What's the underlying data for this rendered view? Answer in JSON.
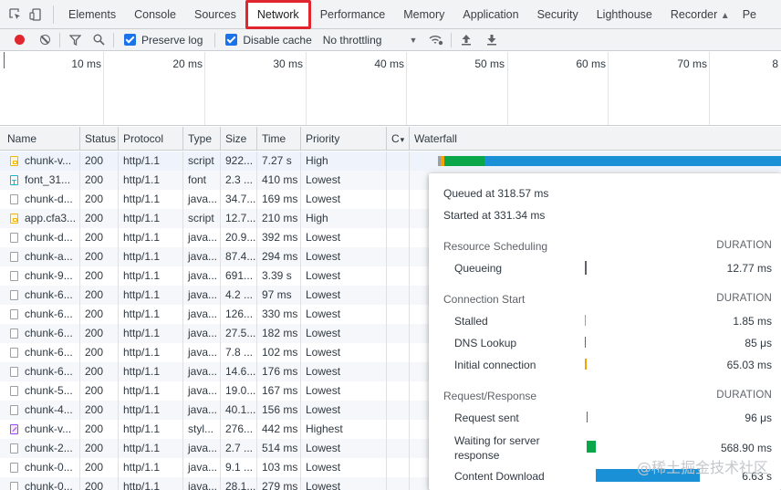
{
  "tabbar": {
    "icons": [
      "inspect-element-icon",
      "device-toolbar-icon"
    ],
    "tabs": [
      "Elements",
      "Console",
      "Sources",
      "Network",
      "Performance",
      "Memory",
      "Application",
      "Security",
      "Lighthouse",
      "Recorder",
      "Pe"
    ],
    "selected_tab": "Network",
    "recorder_icon": "flask-icon"
  },
  "toolbar": {
    "preserve_log": "Preserve log",
    "preserve_log_checked": true,
    "disable_cache": "Disable cache",
    "disable_cache_checked": true,
    "throttling": "No throttling"
  },
  "overview": {
    "ticks": [
      "10 ms",
      "20 ms",
      "30 ms",
      "40 ms",
      "50 ms",
      "60 ms",
      "70 ms",
      "8"
    ]
  },
  "table": {
    "columns": [
      "Name",
      "Status",
      "Protocol",
      "Type",
      "Size",
      "Time",
      "Priority",
      "C",
      "Waterfall"
    ],
    "rows": [
      {
        "icon": "js",
        "name": "chunk-v...",
        "status": "200",
        "protocol": "http/1.1",
        "type": "script",
        "size": "922...",
        "time": "7.27 s",
        "priority": "High"
      },
      {
        "icon": "font",
        "name": "font_31...",
        "status": "200",
        "protocol": "http/1.1",
        "type": "font",
        "size": "2.3 ...",
        "time": "410 ms",
        "priority": "Lowest"
      },
      {
        "icon": "doc",
        "name": "chunk-d...",
        "status": "200",
        "protocol": "http/1.1",
        "type": "java...",
        "size": "34.7...",
        "time": "169 ms",
        "priority": "Lowest"
      },
      {
        "icon": "js",
        "name": "app.cfa3...",
        "status": "200",
        "protocol": "http/1.1",
        "type": "script",
        "size": "12.7...",
        "time": "210 ms",
        "priority": "High"
      },
      {
        "icon": "doc",
        "name": "chunk-d...",
        "status": "200",
        "protocol": "http/1.1",
        "type": "java...",
        "size": "20.9...",
        "time": "392 ms",
        "priority": "Lowest"
      },
      {
        "icon": "doc",
        "name": "chunk-a...",
        "status": "200",
        "protocol": "http/1.1",
        "type": "java...",
        "size": "87.4...",
        "time": "294 ms",
        "priority": "Lowest"
      },
      {
        "icon": "doc",
        "name": "chunk-9...",
        "status": "200",
        "protocol": "http/1.1",
        "type": "java...",
        "size": "691...",
        "time": "3.39 s",
        "priority": "Lowest"
      },
      {
        "icon": "doc",
        "name": "chunk-6...",
        "status": "200",
        "protocol": "http/1.1",
        "type": "java...",
        "size": "4.2 ...",
        "time": "97 ms",
        "priority": "Lowest"
      },
      {
        "icon": "doc",
        "name": "chunk-6...",
        "status": "200",
        "protocol": "http/1.1",
        "type": "java...",
        "size": "126...",
        "time": "330 ms",
        "priority": "Lowest"
      },
      {
        "icon": "doc",
        "name": "chunk-6...",
        "status": "200",
        "protocol": "http/1.1",
        "type": "java...",
        "size": "27.5...",
        "time": "182 ms",
        "priority": "Lowest"
      },
      {
        "icon": "doc",
        "name": "chunk-6...",
        "status": "200",
        "protocol": "http/1.1",
        "type": "java...",
        "size": "7.8 ...",
        "time": "102 ms",
        "priority": "Lowest"
      },
      {
        "icon": "doc",
        "name": "chunk-6...",
        "status": "200",
        "protocol": "http/1.1",
        "type": "java...",
        "size": "14.6...",
        "time": "176 ms",
        "priority": "Lowest"
      },
      {
        "icon": "doc",
        "name": "chunk-5...",
        "status": "200",
        "protocol": "http/1.1",
        "type": "java...",
        "size": "19.0...",
        "time": "167 ms",
        "priority": "Lowest"
      },
      {
        "icon": "doc",
        "name": "chunk-4...",
        "status": "200",
        "protocol": "http/1.1",
        "type": "java...",
        "size": "40.1...",
        "time": "156 ms",
        "priority": "Lowest"
      },
      {
        "icon": "css",
        "name": "chunk-v...",
        "status": "200",
        "protocol": "http/1.1",
        "type": "styl...",
        "size": "276...",
        "time": "442 ms",
        "priority": "Highest"
      },
      {
        "icon": "doc",
        "name": "chunk-2...",
        "status": "200",
        "protocol": "http/1.1",
        "type": "java...",
        "size": "2.7 ...",
        "time": "514 ms",
        "priority": "Lowest"
      },
      {
        "icon": "doc",
        "name": "chunk-0...",
        "status": "200",
        "protocol": "http/1.1",
        "type": "java...",
        "size": "9.1 ...",
        "time": "103 ms",
        "priority": "Lowest"
      },
      {
        "icon": "doc",
        "name": "chunk-0...",
        "status": "200",
        "protocol": "http/1.1",
        "type": "java...",
        "size": "28.1...",
        "time": "279 ms",
        "priority": "Lowest"
      }
    ]
  },
  "colors": {
    "queueing": "#5f6368",
    "stalled": "#9aa0a6",
    "dns": "#009688",
    "connection": "#f4a300",
    "request_sent": "#1a73e8",
    "waiting": "#0aa64a",
    "download": "#1a90d6",
    "selected_tab_border": "#e0262f"
  },
  "timing": {
    "queued_at": "Queued at 318.57 ms",
    "started_at": "Started at 331.34 ms",
    "duration_label": "DURATION",
    "sections": [
      {
        "title": "Resource Scheduling",
        "items": [
          {
            "label": "Queueing",
            "value": "12.77 ms"
          }
        ]
      },
      {
        "title": "Connection Start",
        "items": [
          {
            "label": "Stalled",
            "value": "1.85 ms"
          },
          {
            "label": "DNS Lookup",
            "value": "85 μs"
          },
          {
            "label": "Initial connection",
            "value": "65.03 ms"
          }
        ]
      },
      {
        "title": "Request/Response",
        "items": [
          {
            "label": "Request sent",
            "value": "96 μs"
          },
          {
            "label": "Waiting for server response",
            "value": "568.90 ms"
          },
          {
            "label": "Content Download",
            "value": "6.63 s"
          }
        ]
      }
    ]
  },
  "watermark": "@稀土掘金技术社区"
}
